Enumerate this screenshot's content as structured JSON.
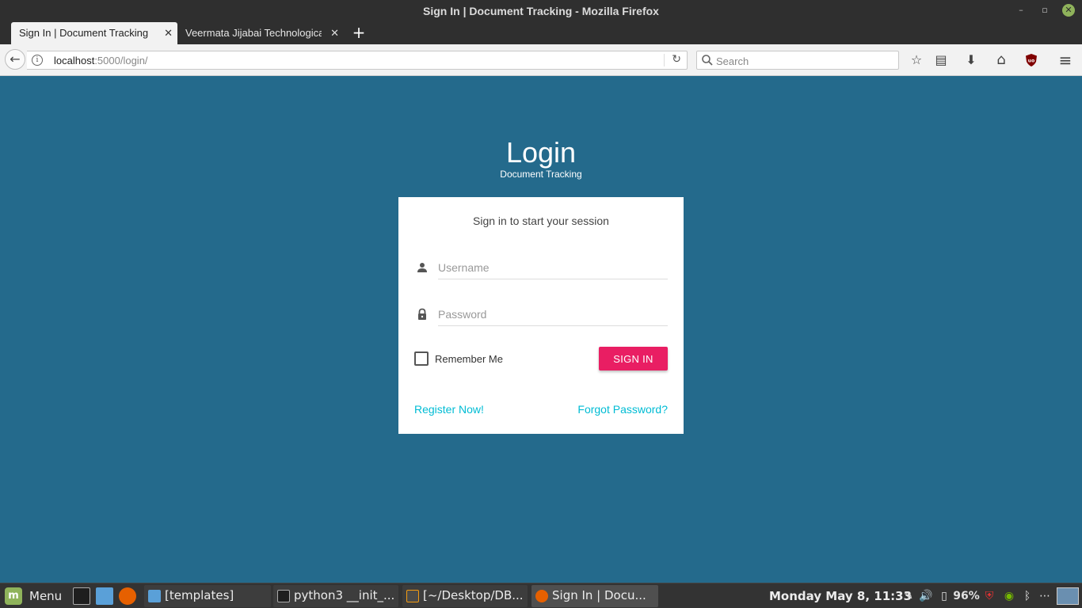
{
  "window": {
    "title": "Sign In | Document Tracking - Mozilla Firefox",
    "minimize_glyph": "–",
    "maximize_glyph": "▫",
    "close_glyph": "✕"
  },
  "tabs": [
    {
      "label": "Sign In | Document Tracking",
      "active": true
    },
    {
      "label": "Veermata Jijabai Technological",
      "active": false
    }
  ],
  "tab_close_glyph": "✕",
  "new_tab_glyph": "+",
  "navbar": {
    "url_host": "localhost",
    "url_rest": ":5000/login/",
    "search_placeholder": "Search",
    "back_glyph": "←",
    "reload_glyph": "↻",
    "info_glyph": "i",
    "icons": {
      "bookmark": "☆",
      "reading_list": "▤",
      "download": "⬇",
      "home": "⌂",
      "menu": "≡"
    },
    "ublock_badge": "uo"
  },
  "login": {
    "title": "Login",
    "subtitle": "Document Tracking",
    "card_message": "Sign in to start your session",
    "username_placeholder": "Username",
    "password_placeholder": "Password",
    "remember_label": "Remember Me",
    "signin_label": "SIGN IN",
    "register_link": "Register Now!",
    "forgot_link": "Forgot Password?"
  },
  "colors": {
    "page_bg": "#246a8c",
    "signin_button": "#e91e63",
    "link": "#00bcd4"
  },
  "taskbar": {
    "menu_label": "Menu",
    "menu_logo_glyph": "m",
    "windows": [
      {
        "label": "[templates]",
        "active": false
      },
      {
        "label": "python3 __init_...",
        "active": false
      },
      {
        "label": "[~/Desktop/DB...",
        "active": false
      },
      {
        "label": "Sign In | Docu...",
        "active": true
      }
    ],
    "clock": "Monday May  8, 11:33",
    "battery": "96%"
  }
}
